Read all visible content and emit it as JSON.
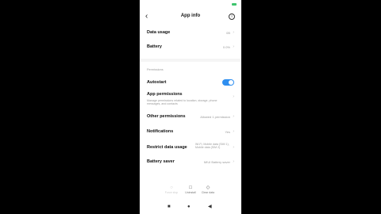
{
  "header": {
    "title": "App info",
    "back_icon": "back-arrow-icon",
    "info_icon": "info-icon"
  },
  "rows": {
    "data_usage": {
      "label": "Data usage",
      "value": "0B"
    },
    "battery": {
      "label": "Battery",
      "value": "0.0%"
    },
    "section_label": "Permissions",
    "autostart": {
      "label": "Autostart",
      "enabled": true
    },
    "app_permissions": {
      "label": "App permissions",
      "desc": "Manage permissions related to location, storage, phone messages, and contacts"
    },
    "other_permissions": {
      "label": "Other permissions",
      "value": "Allowed 1 permission"
    },
    "notifications": {
      "label": "Notifications",
      "value": "Yes"
    },
    "restrict_data": {
      "label": "Restrict data usage",
      "value": "Wi-Fi, Mobile data (SIM 1), Mobile data (SIM 2)"
    },
    "battery_saver": {
      "label": "Battery saver",
      "value": "MIUI Battery saver"
    }
  },
  "actions": {
    "force_stop": "Force stop",
    "uninstall": "Uninstall",
    "clear_data": "Clear data"
  },
  "colors": {
    "accent": "#2f8ff0"
  }
}
